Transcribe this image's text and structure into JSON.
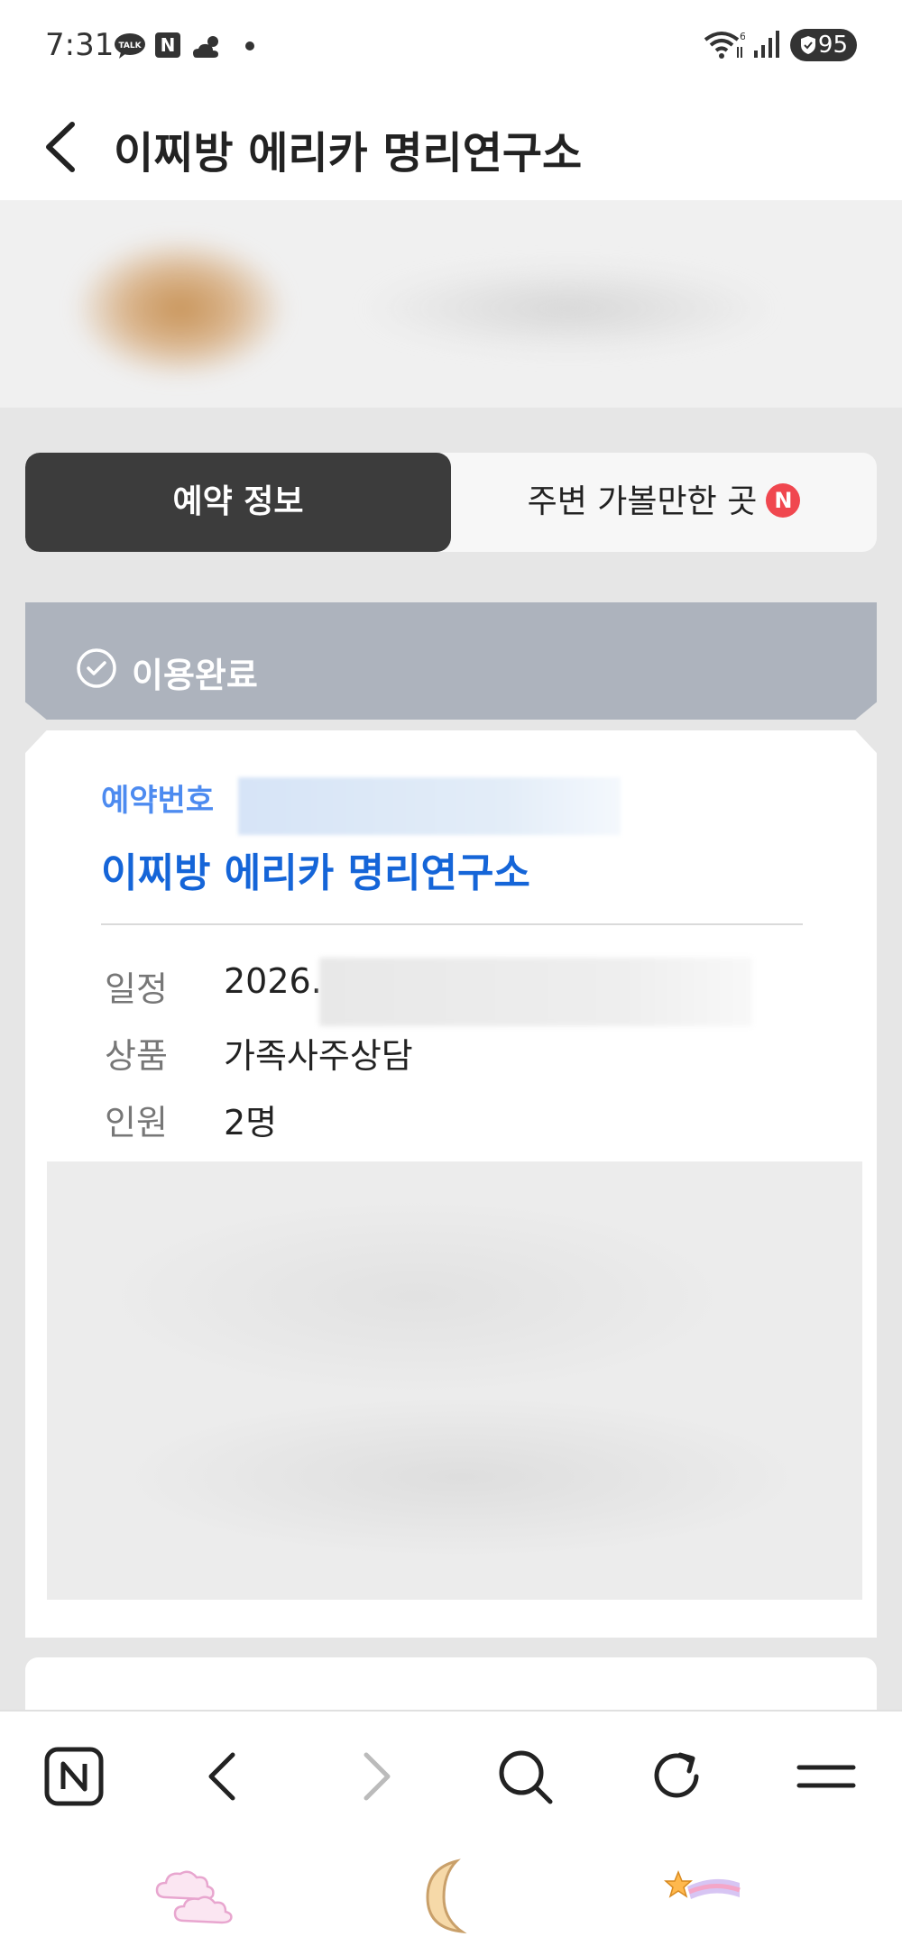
{
  "status_bar": {
    "time": "7:31",
    "notification_icons": [
      "talk-icon",
      "naver-n-icon",
      "weather-icon",
      "dot-icon"
    ],
    "battery": "95"
  },
  "header": {
    "title": "이찌방 에리카 명리연구소"
  },
  "tabs": [
    {
      "label": "예약 정보",
      "active": true
    },
    {
      "label": "주변 가볼만한 곳",
      "active": false,
      "badge": "N"
    }
  ],
  "status": {
    "label": "이용완료"
  },
  "reservation": {
    "number_label": "예약번호",
    "place_name": "이찌방 에리카 명리연구소",
    "rows": [
      {
        "label": "일정",
        "value": "2026."
      },
      {
        "label": "상품",
        "value": "가족사주상담"
      },
      {
        "label": "인원",
        "value": "2명"
      }
    ]
  },
  "bottom_nav": {
    "items": [
      "naver-n-icon",
      "back-icon",
      "forward-icon",
      "search-icon",
      "refresh-icon",
      "menu-icon"
    ]
  },
  "colors": {
    "accent_blue": "#1565d8",
    "label_blue": "#4d8bf0",
    "tab_active_bg": "#3c3c3c",
    "status_banner_bg": "#adb3bd",
    "badge_red": "#f0474f"
  }
}
